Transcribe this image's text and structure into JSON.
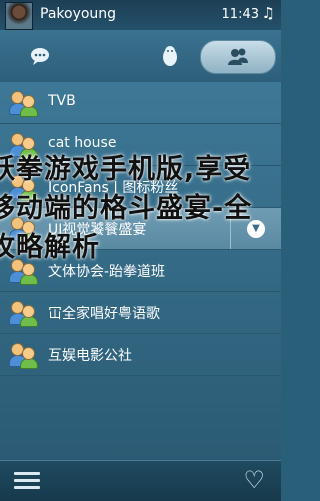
{
  "status_bar": {
    "username": "Pakoyoung",
    "time": "11:43"
  },
  "tabs": [
    {
      "icon": "chat-bubble-icon"
    },
    {
      "icon": "qq-penguin-icon"
    },
    {
      "icon": "contacts-icon",
      "selected": true
    }
  ],
  "groups": [
    {
      "label": "TVB"
    },
    {
      "label": "cat house"
    },
    {
      "label": "IconFans | 图标粉丝"
    },
    {
      "label": "UI视觉饕餮盛宴",
      "selected": true
    },
    {
      "label": "文体协会-跆拳道班"
    },
    {
      "label": "冚全家唱好粤语歌"
    },
    {
      "label": "互娱电影公社"
    }
  ],
  "overlay": {
    "line1": "跃拳游戏手机版,享受",
    "line2": "移动端的格斗盛宴-全",
    "line3": "攻略解析"
  },
  "colors": {
    "accent": "#3d7896",
    "selected_row": "#6f9cb3"
  }
}
